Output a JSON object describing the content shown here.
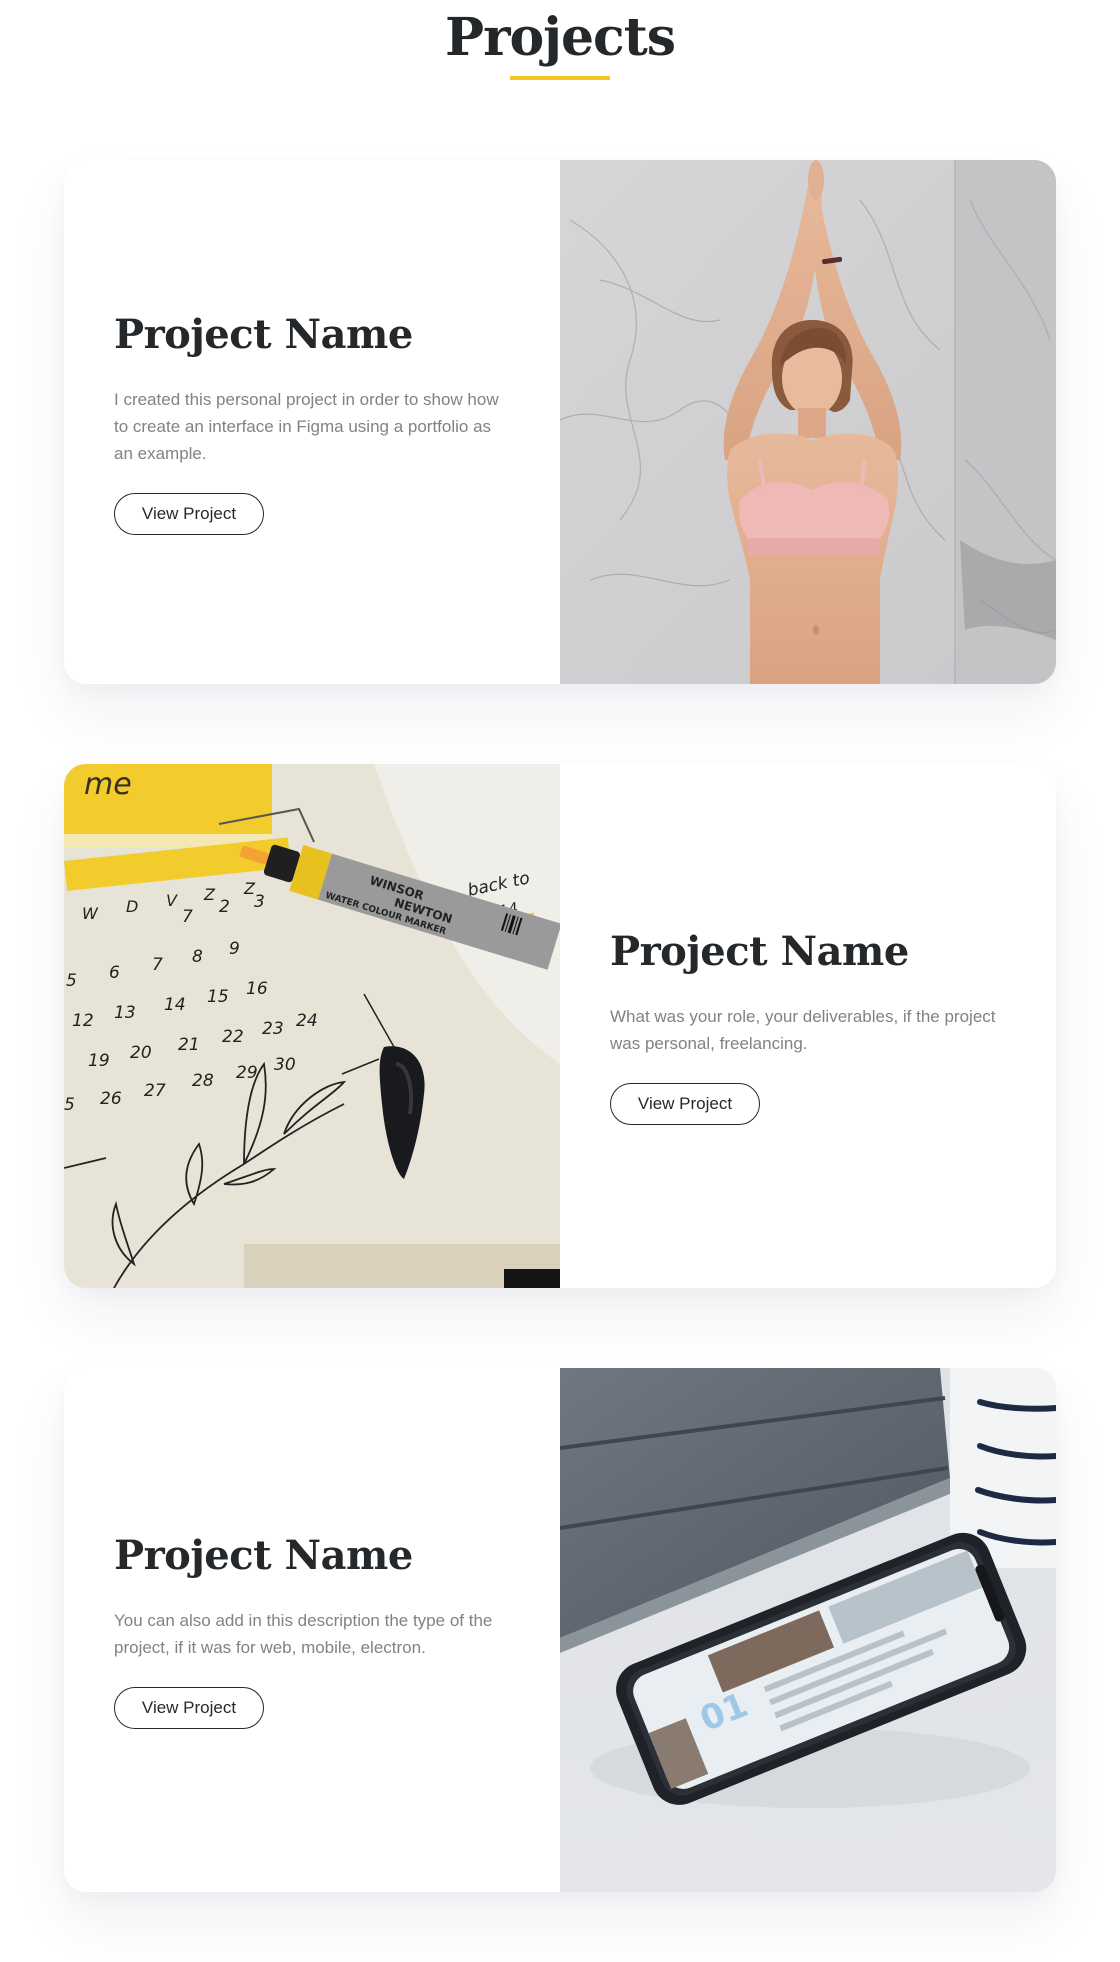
{
  "page": {
    "title": "Projects"
  },
  "colors": {
    "accent": "#f6c524",
    "heading": "#25282b",
    "body_text": "#828282"
  },
  "projects": [
    {
      "name": "Project Name",
      "description": "I created this personal project in order to show how to create an interface in Figma using a portfolio as an example.",
      "button_label": "View Project",
      "image": "photo of woman doing yoga with arms raised against marble wall"
    },
    {
      "name": "Project Name",
      "description": "What was your role, your deliverables, if the project was personal, freelancing.",
      "button_label": "View Project",
      "image": "photo of calendar notebook with yellow marker pen",
      "marker_text": {
        "brand1": "WINSOR",
        "brand2": "NEWTON",
        "label": "WATER COLOUR MARKER"
      },
      "calendar_days": [
        "W",
        "D",
        "V",
        "Z",
        "Z"
      ]
    },
    {
      "name": "Project Name",
      "description": "You can also add in this description the type of the project, if it was for web, mobile, electron.",
      "button_label": "View Project",
      "image": "photo of smartphone on desk next to tablet and striped mug"
    }
  ]
}
